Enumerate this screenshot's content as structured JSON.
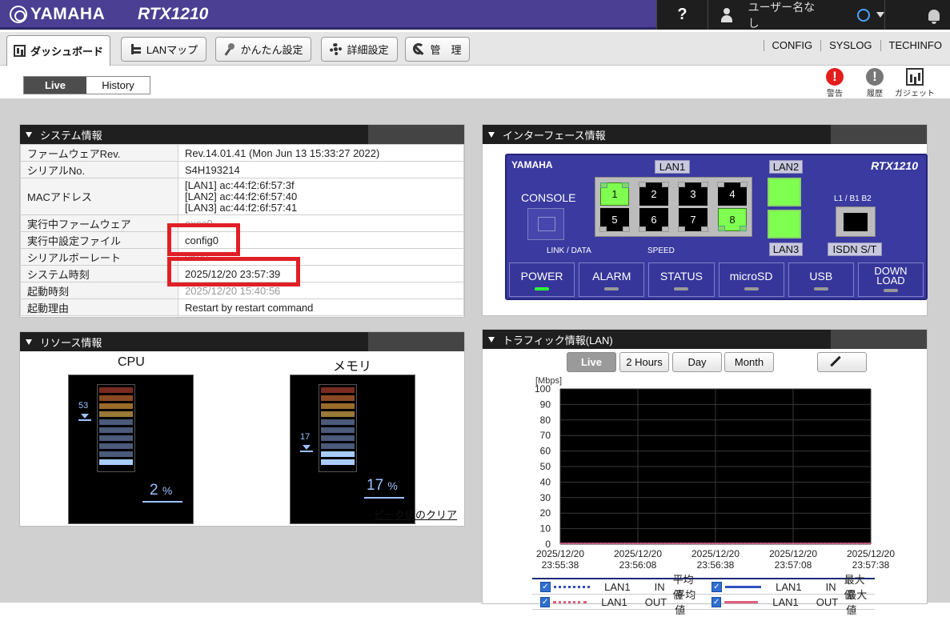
{
  "app": {
    "brand": "YAMAHA",
    "model": "RTX1210"
  },
  "header": {
    "help_label": "?",
    "user_label": "ユーザー名なし"
  },
  "nav": {
    "tabs": [
      {
        "label": "ダッシュボード",
        "icon": "dashboard-icon",
        "active": true
      },
      {
        "label": "LANマップ",
        "icon": "lanmap-icon"
      },
      {
        "label": "かんたん設定",
        "icon": "wizard-icon"
      },
      {
        "label": "詳細設定",
        "icon": "gear-icon"
      },
      {
        "label": "管　理",
        "icon": "wrench-icon"
      }
    ],
    "links": [
      "CONFIG",
      "SYSLOG",
      "TECHINFO"
    ]
  },
  "view": {
    "live_label": "Live",
    "history_label": "History"
  },
  "tools": {
    "warning_label": "警告",
    "history_label": "履歴",
    "gadget_label": "ガジェット",
    "warning_glyph": "!",
    "history_glyph": "!"
  },
  "system": {
    "title": "システム情報",
    "rows": [
      {
        "key": "ファームウェアRev.",
        "value": "Rev.14.01.41 (Mon Jun 13 15:33:27 2022)"
      },
      {
        "key": "シリアルNo.",
        "value": "S4H193214"
      },
      {
        "key": "MACアドレス",
        "lines": [
          "[LAN1] ac:44:f2:6f:57:3f",
          "[LAN2] ac:44:f2:6f:57:40",
          "[LAN3] ac:44:f2:6f:57:41"
        ]
      },
      {
        "key": "実行中ファームウェア",
        "value": "exec0"
      },
      {
        "key": "実行中設定ファイル",
        "value": "config0"
      },
      {
        "key": "シリアルボーレート",
        "value": "9600"
      },
      {
        "key": "システム時刻",
        "value": "2025/12/20 23:57:39"
      },
      {
        "key": "起動時刻",
        "value": "2025/12/20 15:40:56"
      },
      {
        "key": "起動理由",
        "value": "Restart by restart command"
      }
    ]
  },
  "resources": {
    "title": "リソース情報",
    "cpu": {
      "label": "CPU",
      "percent": "2",
      "unit": "%",
      "peak": "53",
      "level_fraction": 0.1
    },
    "memory": {
      "label": "メモリ",
      "percent": "17",
      "unit": "%",
      "peak": "17",
      "level_fraction": 0.2
    },
    "clear_peak_label": "ピーク値のクリア"
  },
  "interface": {
    "title": "インターフェース情報",
    "device_logo": "YAMAHA",
    "device_model": "RTX1210",
    "lan1_label": "LAN1",
    "lan2_label": "LAN2",
    "lan3_label": "LAN3",
    "console_label": "CONSOLE",
    "isdn_port_label": "L1 / B1 B2",
    "isdn_label": "ISDN S/T",
    "link_data_label": "LINK / DATA",
    "speed_label": "SPEED",
    "ports": [
      {
        "num": "1",
        "link": true
      },
      {
        "num": "2",
        "link": false
      },
      {
        "num": "3",
        "link": false
      },
      {
        "num": "4",
        "link": false
      },
      {
        "num": "5",
        "link": false
      },
      {
        "num": "6",
        "link": false
      },
      {
        "num": "7",
        "link": false
      },
      {
        "num": "8",
        "link": true
      }
    ],
    "leds": [
      {
        "label": "POWER",
        "on": true
      },
      {
        "label": "ALARM",
        "on": false
      },
      {
        "label": "STATUS",
        "on": false
      },
      {
        "label": "microSD",
        "on": false
      },
      {
        "label": "USB",
        "on": false
      },
      {
        "label": "DOWN LOAD",
        "line1": "DOWN",
        "line2": "LOAD",
        "on": false
      }
    ]
  },
  "traffic": {
    "title": "トラフィック情報(LAN)",
    "range_buttons": [
      "Live",
      "2 Hours",
      "Day",
      "Month"
    ],
    "active_range": "Live",
    "legend": [
      {
        "iface": "LAN1",
        "dir": "IN",
        "stat": "平均値",
        "style": "dots",
        "color": "#3050c0"
      },
      {
        "iface": "LAN1",
        "dir": "IN",
        "stat": "最大値",
        "style": "solid",
        "color": "#3050c0"
      },
      {
        "iface": "LAN1",
        "dir": "OUT",
        "stat": "平均値",
        "style": "dots",
        "color": "#e06080"
      },
      {
        "iface": "LAN1",
        "dir": "OUT",
        "stat": "最大値",
        "style": "solid",
        "color": "#e06080"
      }
    ]
  },
  "chart_data": {
    "type": "line",
    "ylabel": "[Mbps]",
    "ylim": [
      0,
      100
    ],
    "yticks": [
      0,
      10,
      20,
      30,
      40,
      50,
      60,
      70,
      80,
      90,
      100
    ],
    "x": [
      "2025/12/20 23:55:38",
      "2025/12/20 23:56:08",
      "2025/12/20 23:56:38",
      "2025/12/20 23:57:08",
      "2025/12/20 23:57:38"
    ],
    "series": [
      {
        "name": "LAN1 IN 平均値",
        "values": [
          0,
          0,
          0,
          0,
          0
        ]
      },
      {
        "name": "LAN1 IN 最大値",
        "values": [
          0,
          0,
          0,
          0,
          0
        ]
      },
      {
        "name": "LAN1 OUT 平均値",
        "values": [
          0,
          0,
          0,
          0,
          0
        ]
      },
      {
        "name": "LAN1 OUT 最大値",
        "values": [
          0,
          0,
          0,
          0,
          0
        ]
      }
    ],
    "background": "#000000",
    "grid": true
  }
}
